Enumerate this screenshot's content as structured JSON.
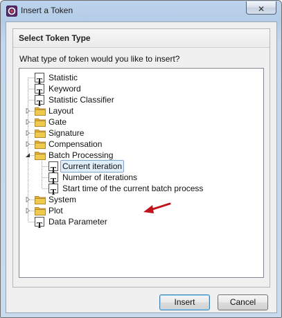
{
  "window": {
    "title": "Insert a Token",
    "close_glyph": "✕",
    "app_icon": "flowjo-app-icon"
  },
  "panel": {
    "header": "Select Token Type",
    "question": "What type of token would you like to insert?"
  },
  "tree": {
    "items": [
      {
        "label": "Statistic",
        "icon": "token-icon",
        "expandable": false,
        "level": 0
      },
      {
        "label": "Keyword",
        "icon": "token-icon",
        "expandable": false,
        "level": 0
      },
      {
        "label": "Statistic Classifier",
        "icon": "token-icon",
        "expandable": false,
        "level": 0
      },
      {
        "label": "Layout",
        "icon": "folder-icon",
        "expandable": true,
        "expanded": false,
        "level": 0
      },
      {
        "label": "Gate",
        "icon": "folder-icon",
        "expandable": true,
        "expanded": false,
        "level": 0
      },
      {
        "label": "Signature",
        "icon": "folder-icon",
        "expandable": true,
        "expanded": false,
        "level": 0
      },
      {
        "label": "Compensation",
        "icon": "folder-icon",
        "expandable": true,
        "expanded": false,
        "level": 0
      },
      {
        "label": "Batch Processing",
        "icon": "folder-icon",
        "expandable": true,
        "expanded": true,
        "level": 0
      },
      {
        "label": "Current iteration",
        "icon": "token-icon",
        "expandable": false,
        "level": 1,
        "selected": true
      },
      {
        "label": "Number of iterations",
        "icon": "token-icon",
        "expandable": false,
        "level": 1
      },
      {
        "label": "Start time of the current batch process",
        "icon": "token-icon",
        "expandable": false,
        "level": 1
      },
      {
        "label": "System",
        "icon": "folder-icon",
        "expandable": true,
        "expanded": false,
        "level": 0
      },
      {
        "label": "Plot",
        "icon": "folder-icon",
        "expandable": true,
        "expanded": false,
        "level": 0
      },
      {
        "label": "Data Parameter",
        "icon": "token-icon",
        "expandable": false,
        "level": 0
      }
    ],
    "token_glyph": "T"
  },
  "buttons": {
    "insert": "Insert",
    "cancel": "Cancel"
  },
  "colors": {
    "arrow": "#c0141a",
    "folder": "#f2c94c",
    "selection": "#e1effb"
  }
}
